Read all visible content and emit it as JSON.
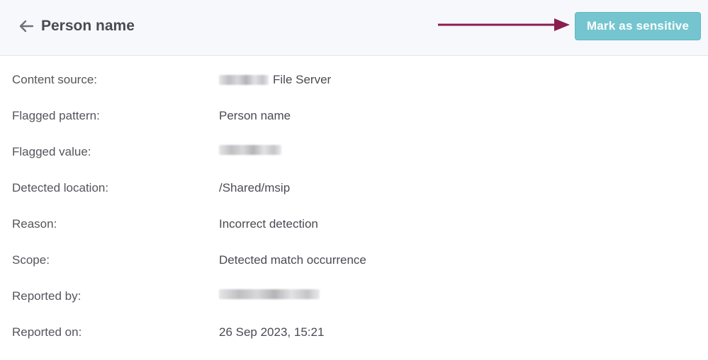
{
  "header": {
    "title": "Person name",
    "action_label": "Mark as sensitive",
    "accent_color": "#74c5d0",
    "arrow_color": "#8a1e4e",
    "icons": {
      "back": "arrow-left-icon",
      "annotation": "arrow-right-icon"
    }
  },
  "details": [
    {
      "label": "Content source:",
      "value": "File Server",
      "redacted_prefix": true
    },
    {
      "label": "Flagged pattern:",
      "value": "Person name"
    },
    {
      "label": "Flagged value:",
      "value": "",
      "redacted": true
    },
    {
      "label": "Detected location:",
      "value": "/Shared/msip"
    },
    {
      "label": "Reason:",
      "value": "Incorrect detection"
    },
    {
      "label": "Scope:",
      "value": "Detected match occurrence"
    },
    {
      "label": "Reported by:",
      "value": "",
      "redacted": true
    },
    {
      "label": "Reported on:",
      "value": "26 Sep 2023, 15:21"
    }
  ]
}
